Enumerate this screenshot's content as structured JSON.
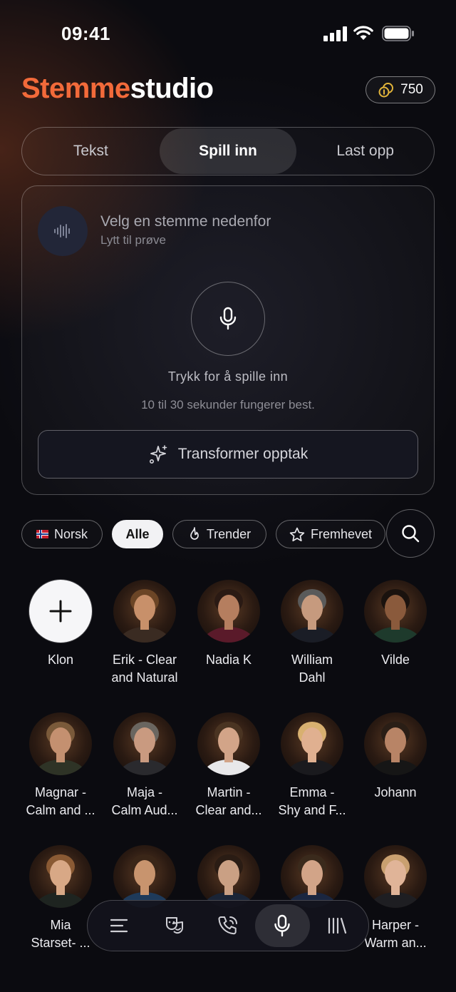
{
  "status": {
    "time": "09:41"
  },
  "header": {
    "title_accent": "Stemme",
    "title_rest": "studio",
    "credits": "750"
  },
  "tabs": [
    {
      "label": "Tekst",
      "active": false
    },
    {
      "label": "Spill inn",
      "active": true
    },
    {
      "label": "Last opp",
      "active": false
    }
  ],
  "recorder": {
    "voice_title": "Velg en stemme nedenfor",
    "voice_subtitle": "Lytt til prøve",
    "hint": "Trykk for å spille inn",
    "tip": "10 til 30 sekunder fungerer best.",
    "transform_label": "Transformer opptak"
  },
  "filters": {
    "language": "Norsk",
    "all": "Alle",
    "trending": "Trender",
    "featured": "Fremhevet"
  },
  "voices": [
    {
      "line1": "Klon",
      "line2": "",
      "kind": "add"
    },
    {
      "line1": "Erik - Clear",
      "line2": "and Natural",
      "skin": "#c8906a",
      "hair": "#6b4526",
      "shirt": "#3a2b22"
    },
    {
      "line1": "Nadia K",
      "line2": "",
      "skin": "#b57e5f",
      "hair": "#2a1a14",
      "shirt": "#5a1a2a"
    },
    {
      "line1": "William",
      "line2": "Dahl",
      "skin": "#c69a7e",
      "hair": "#5a5a5a",
      "shirt": "#1a1d26"
    },
    {
      "line1": "Vilde",
      "line2": "",
      "skin": "#8a5a3c",
      "hair": "#1a120e",
      "shirt": "#1e3a2c"
    },
    {
      "line1": "Magnar -",
      "line2": "Calm and ...",
      "skin": "#c49070",
      "hair": "#7a5a3a",
      "shirt": "#2e3326"
    },
    {
      "line1": "Maja -",
      "line2": "Calm Aud...",
      "skin": "#c99a80",
      "hair": "#6a6660",
      "shirt": "#2a2a2e"
    },
    {
      "line1": "Martin -",
      "line2": "Clear and...",
      "skin": "#d2a488",
      "hair": "#4a3422",
      "shirt": "#e8e8ea"
    },
    {
      "line1": "Emma -",
      "line2": "Shy and F...",
      "skin": "#e0b090",
      "hair": "#d8b070",
      "shirt": "#1a1a1e"
    },
    {
      "line1": "Johann",
      "line2": "",
      "skin": "#b88466",
      "hair": "#2a1e16",
      "shirt": "#161616"
    },
    {
      "line1": "Mia",
      "line2": "Starset- ...",
      "skin": "#d8a886",
      "hair": "#8a5a34",
      "shirt": "#1e2420"
    },
    {
      "line1": "",
      "line2": "",
      "skin": "#c8946e",
      "hair": "#3a2618",
      "shirt": "#1e3a5a"
    },
    {
      "line1": "",
      "line2": "",
      "skin": "#caa084",
      "hair": "#2a1c14",
      "shirt": "#1a2436"
    },
    {
      "line1": "",
      "line2": "",
      "skin": "#d2a488",
      "hair": "#3a2a1c",
      "shirt": "#1a2640"
    },
    {
      "line1": "Harper -",
      "line2": "Warm an...",
      "skin": "#e0b498",
      "hair": "#c9a070",
      "shirt": "#1e1e22"
    }
  ],
  "nav": [
    {
      "icon": "menu-icon",
      "active": false
    },
    {
      "icon": "theater-masks-icon",
      "active": false
    },
    {
      "icon": "phone-call-icon",
      "active": false
    },
    {
      "icon": "microphone-icon",
      "active": true
    },
    {
      "icon": "library-icon",
      "active": false
    }
  ],
  "colors": {
    "accent": "#f26a3a",
    "background": "#0b0b10"
  }
}
